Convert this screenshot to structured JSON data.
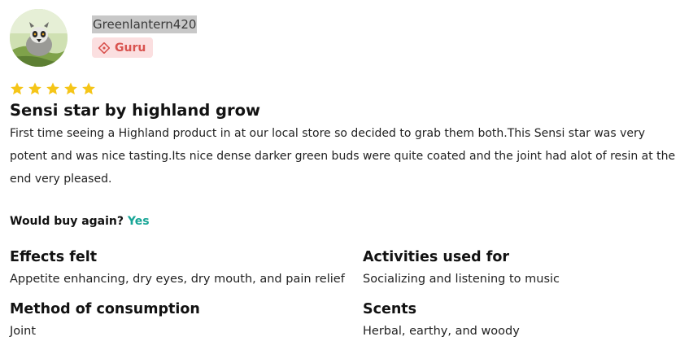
{
  "user": {
    "username": "Greenlantern420",
    "badge": "Guru",
    "avatar_icon": "lemur-avatar"
  },
  "rating": {
    "stars": 5,
    "max": 5,
    "color": "#f5c518"
  },
  "review": {
    "title": "Sensi star by highland grow",
    "body": "First time seeing a Highland product in at our local store so decided to grab them both.This Sensi star was very potent and was nice tasting.Its nice dense darker green buds were quite coated and the joint had alot of resin at the end very pleased."
  },
  "buy_again": {
    "label": "Would buy again?",
    "value": "Yes",
    "value_color": "#17a596"
  },
  "details": {
    "effects": {
      "title": "Effects felt",
      "value": "Appetite enhancing, dry eyes, dry mouth, and pain relief"
    },
    "activities": {
      "title": "Activities used for",
      "value": "Socializing and listening to music"
    },
    "method": {
      "title": "Method of consumption",
      "value": "Joint"
    },
    "scents": {
      "title": "Scents",
      "value": "Herbal, earthy, and woody"
    }
  },
  "colors": {
    "badge_bg": "#fbdfe0",
    "badge_text": "#d9534f"
  }
}
